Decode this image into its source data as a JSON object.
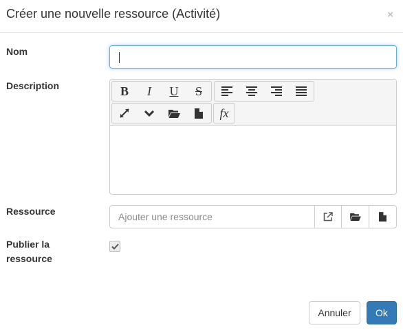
{
  "modal": {
    "title": "Créer une nouvelle ressource (Activité)",
    "close_label": "×"
  },
  "form": {
    "nom": {
      "label": "Nom",
      "value": ""
    },
    "description": {
      "label": "Description",
      "toolbar": {
        "row1_group1": [
          {
            "name": "bold",
            "glyph": "B"
          },
          {
            "name": "italic",
            "glyph": "I"
          },
          {
            "name": "underline",
            "glyph": "U"
          },
          {
            "name": "strikethrough",
            "glyph": "S"
          }
        ],
        "row1_group2": [
          "align-left-icon",
          "align-center-icon",
          "align-right-icon",
          "align-justify-icon"
        ],
        "row2": [
          "fullscreen-icon",
          "chevron-down-icon",
          "folder-open-icon",
          "file-icon"
        ],
        "formula_glyph": "fx"
      }
    },
    "ressource": {
      "label": "Ressource",
      "placeholder": "Ajouter une ressource",
      "addons": [
        "external-link-icon",
        "folder-open-icon",
        "file-icon"
      ]
    },
    "publier": {
      "label_line1": "Publier la",
      "label_line2": "ressource",
      "checked": true
    }
  },
  "footer": {
    "cancel_label": "Annuler",
    "ok_label": "Ok"
  },
  "colors": {
    "primary": "#337ab7",
    "focus_border": "#66afe9",
    "border": "#cccccc"
  }
}
